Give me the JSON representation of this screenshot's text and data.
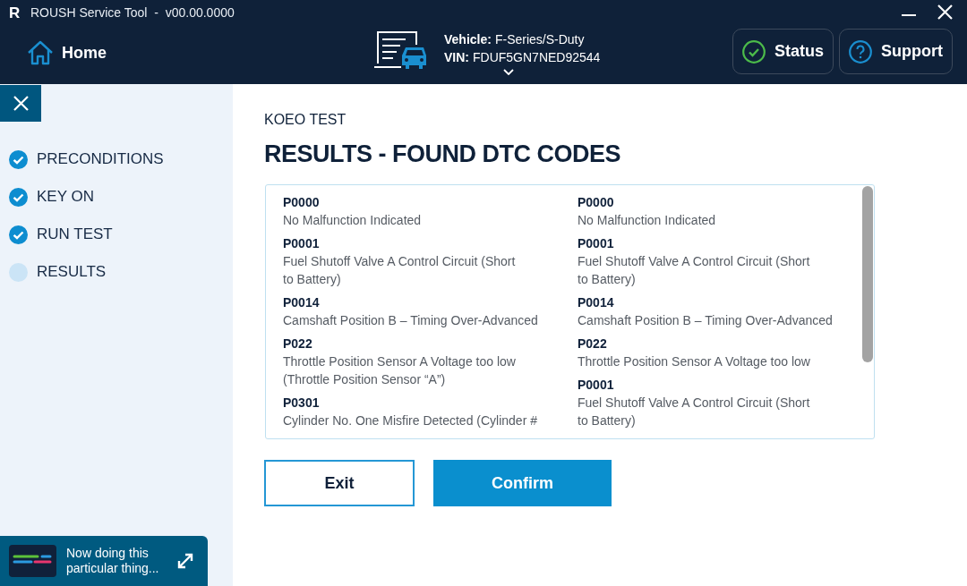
{
  "window": {
    "logo": "R",
    "title": "ROUSH Service Tool  -  v00.00.0000"
  },
  "header": {
    "home": "Home",
    "vehicle": {
      "label": "Vehicle:",
      "value": "F-Series/S-Duty"
    },
    "vin": {
      "label": "VIN:",
      "value": "FDUF5GN7NED92544"
    },
    "buttons": [
      {
        "label": "Status",
        "kind": "status"
      },
      {
        "label": "Support",
        "kind": "support"
      }
    ]
  },
  "sidebar": {
    "steps": [
      {
        "label": "PRECONDITIONS",
        "completed": true
      },
      {
        "label": "KEY ON",
        "completed": true
      },
      {
        "label": "RUN TEST",
        "completed": true
      },
      {
        "label": "RESULTS",
        "completed": false
      }
    ],
    "task": {
      "text": "Now doing this\nparticular thing..."
    }
  },
  "main": {
    "subtitle": "KOEO TEST",
    "heading": "RESULTS - FOUND DTC CODES",
    "dtc_columns": [
      [
        {
          "code": "P0000",
          "description": "No Malfunction Indicated"
        },
        {
          "code": "P0001",
          "description": "Fuel Shutoff Valve A Control Circuit (Short\nto Battery)"
        },
        {
          "code": "P0014",
          "description": "Camshaft Position B – Timing Over-Advanced"
        },
        {
          "code": "P022",
          "description": "Throttle Position Sensor A Voltage too low\n(Throttle Position Sensor “A”)"
        },
        {
          "code": "P0301",
          "description": "Cylinder No. One Misfire Detected (Cylinder #"
        }
      ],
      [
        {
          "code": "P0000",
          "description": "No Malfunction Indicated"
        },
        {
          "code": "P0001",
          "description": "Fuel Shutoff Valve A Control Circuit (Short\nto Battery)"
        },
        {
          "code": "P0014",
          "description": "Camshaft Position B – Timing Over-Advanced"
        },
        {
          "code": "P022",
          "description": "Throttle Position Sensor A Voltage too low"
        },
        {
          "code": "P0001",
          "description": "Fuel Shutoff Valve A Control Circuit (Short\nto Battery)"
        }
      ]
    ],
    "buttons": [
      {
        "label": "Exit",
        "kind": "secondary"
      },
      {
        "label": "Confirm",
        "kind": "primary"
      }
    ]
  }
}
